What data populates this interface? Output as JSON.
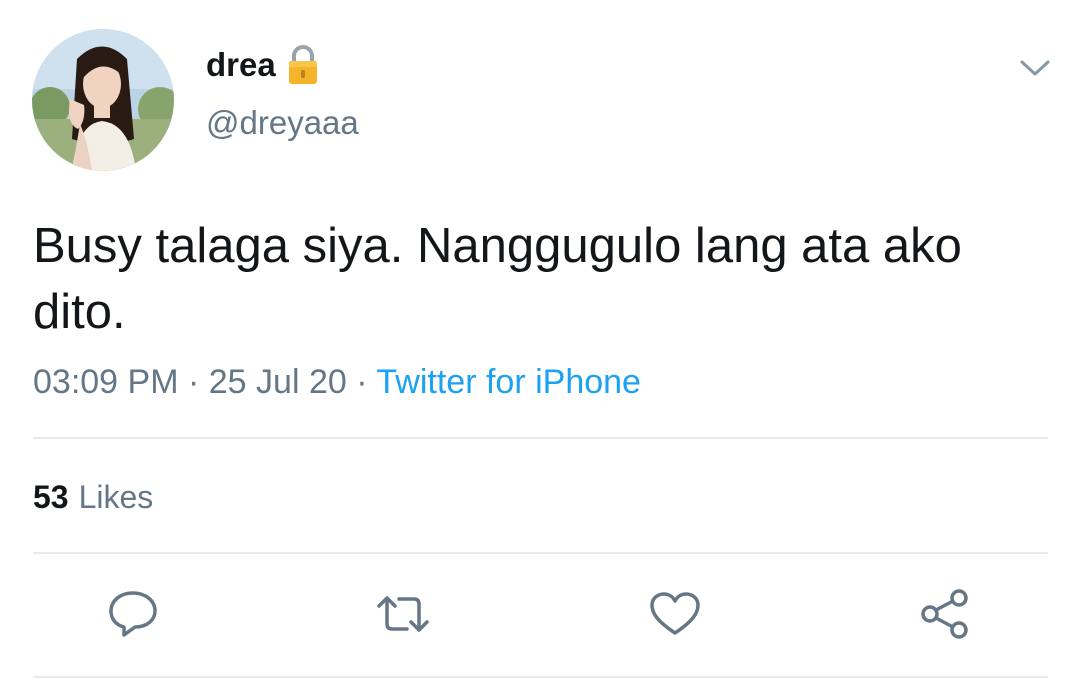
{
  "user": {
    "display_name": "drea",
    "handle": "@dreyaaa",
    "locked_icon": "lock-icon",
    "avatar_icon": "profile-photo"
  },
  "tweet": {
    "text": "Busy talaga siya. Nanggugulo lang ata ako dito.",
    "time": "03:09 PM",
    "separator": "·",
    "date": "25 Jul 20",
    "source": "Twitter for iPhone"
  },
  "stats": {
    "likes_count": "53",
    "likes_label": "Likes"
  },
  "actions": [
    "reply-icon",
    "retweet-icon",
    "like-icon",
    "share-icon"
  ],
  "colors": {
    "text": "#14171a",
    "secondary": "#657786",
    "link": "#1da1f2",
    "divider": "#e6ecf0"
  }
}
